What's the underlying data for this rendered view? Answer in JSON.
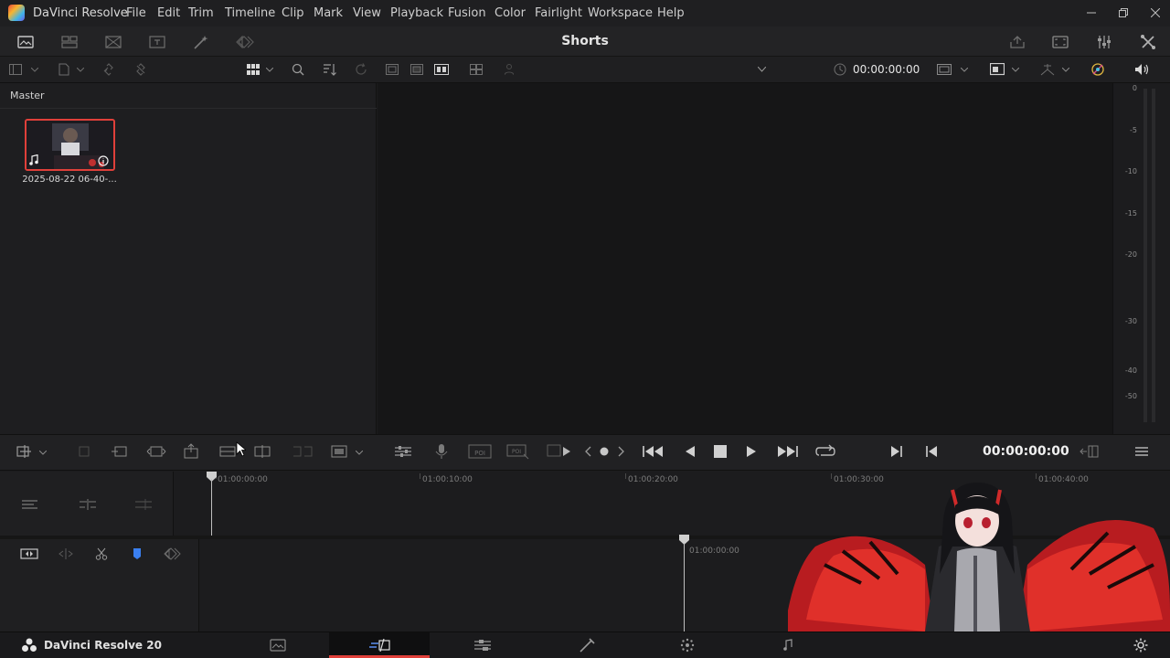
{
  "app": {
    "name": "DaVinci Resolve",
    "menu": [
      "File",
      "Edit",
      "Trim",
      "Timeline",
      "Clip",
      "Mark",
      "View",
      "Playback",
      "Fusion",
      "Color",
      "Fairlight",
      "Workspace",
      "Help"
    ]
  },
  "project": {
    "title": "Shorts"
  },
  "media_pool": {
    "bin_label": "Master",
    "clips": [
      {
        "name": "2025-08-22 06-40-..."
      }
    ]
  },
  "viewer": {
    "timecode": "00:00:00:00"
  },
  "meter": {
    "ticks": [
      "0",
      "-5",
      "-10",
      "-15",
      "-20",
      "-30",
      "-40",
      "-50"
    ]
  },
  "transport": {
    "timecode": "00:00:00:00"
  },
  "timeline": {
    "upper_ruler": [
      "01:00:00:00",
      "01:00:10:00",
      "01:00:20:00",
      "01:00:30:00",
      "01:00:40:00"
    ],
    "lower_ruler": [
      "01:00:00:00"
    ]
  },
  "pagebar": {
    "brand": "DaVinci Resolve 20",
    "active_page": "cut"
  },
  "colors": {
    "accent": "#e0403a",
    "marker": "#3a7ff0"
  }
}
